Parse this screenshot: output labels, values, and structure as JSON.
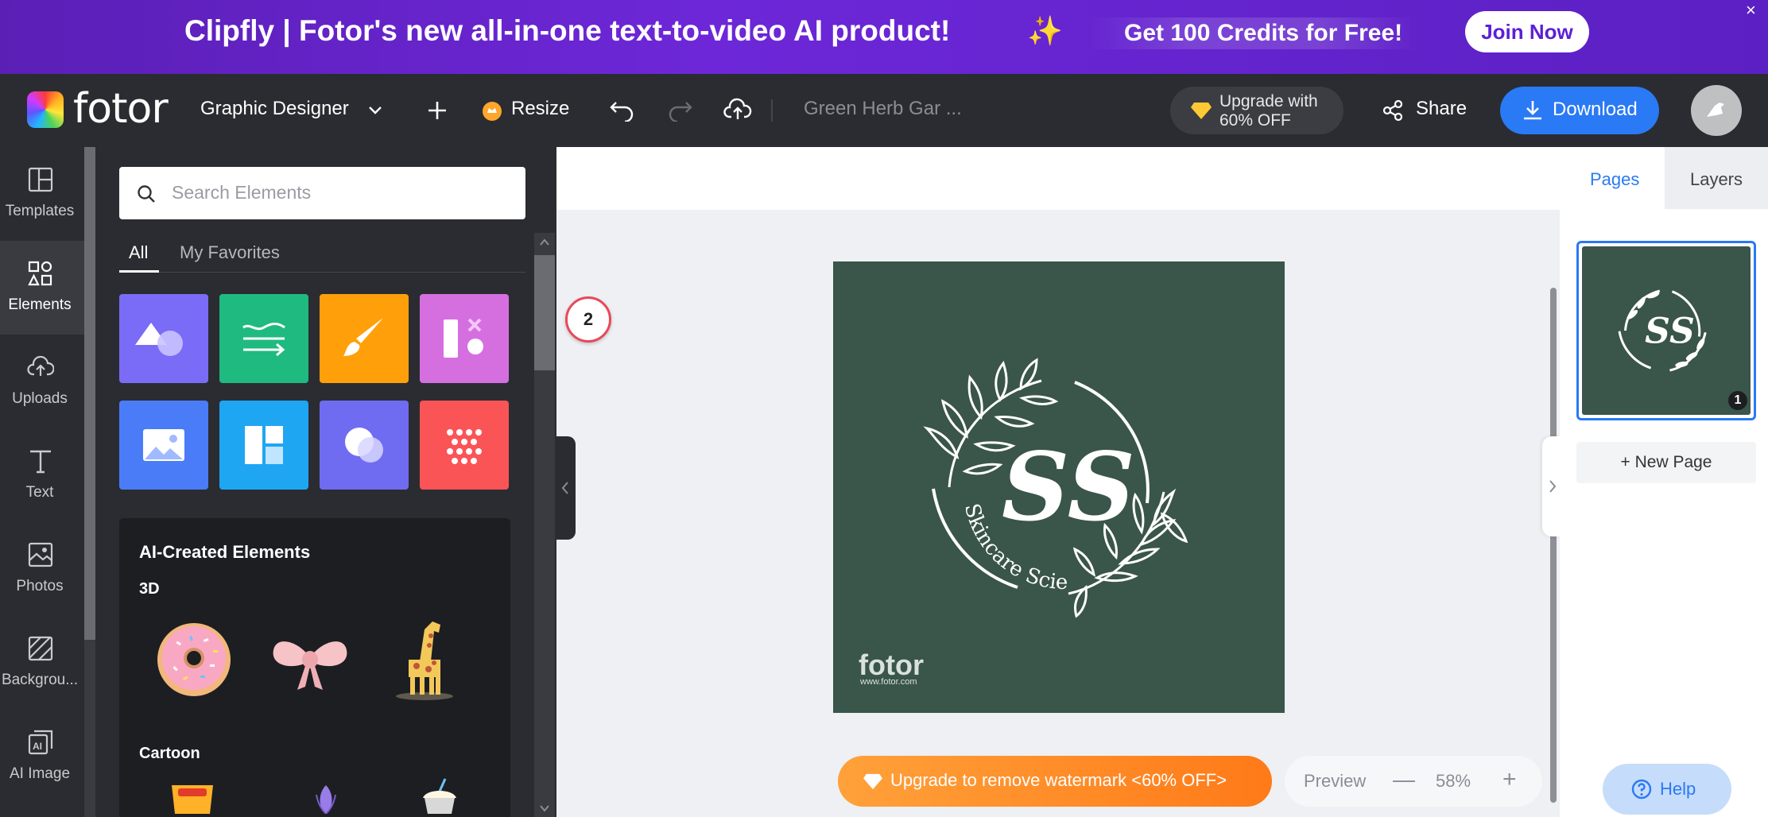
{
  "promo": {
    "headline": "Clipfly | Fotor's new all-in-one text-to-video AI product!",
    "sparkle": "✨",
    "credits": "Get 100 Credits for Free!",
    "join_label": "Join Now",
    "close": "×"
  },
  "topbar": {
    "logo_text": "fotor",
    "designer_label": "Graphic Designer",
    "resize_label": "Resize",
    "doc_title": "Green Herb Gar  ...",
    "upgrade_line1": "Upgrade with",
    "upgrade_line2": "60% OFF",
    "share_label": "Share",
    "download_label": "Download"
  },
  "rail": {
    "items": [
      {
        "label": "Templates"
      },
      {
        "label": "Elements"
      },
      {
        "label": "Uploads"
      },
      {
        "label": "Text"
      },
      {
        "label": "Photos"
      },
      {
        "label": "Backgrou..."
      },
      {
        "label": "AI Image"
      }
    ]
  },
  "panel": {
    "search_placeholder": "Search Elements",
    "tabs": [
      {
        "label": "All"
      },
      {
        "label": "My Favorites"
      }
    ],
    "tile_colors": [
      "#7a6cf6",
      "#1fba7f",
      "#ffa00a",
      "#d56fe0",
      "#4a7cf7",
      "#1ea6f2",
      "#6f6cf2",
      "#fa5457"
    ],
    "ai_title": "AI-Created Elements",
    "ai_sections": [
      {
        "label": "3D"
      },
      {
        "label": "Cartoon"
      }
    ]
  },
  "canvas": {
    "badge_count": "2",
    "monogram": "SS",
    "tagline": "Skincare Science",
    "watermark_brand": "fotor",
    "watermark_url": "www.fotor.com",
    "bg_color": "#3a554a"
  },
  "bottom": {
    "watermark_btn": "Upgrade to remove watermark <60% OFF>",
    "preview_label": "Preview",
    "zoom_minus": "—",
    "zoom_pct": "58%",
    "zoom_plus": "+"
  },
  "right": {
    "tab_pages": "Pages",
    "tab_layers": "Layers",
    "page_number": "1",
    "new_page": "+ New Page",
    "help_label": "Help"
  }
}
